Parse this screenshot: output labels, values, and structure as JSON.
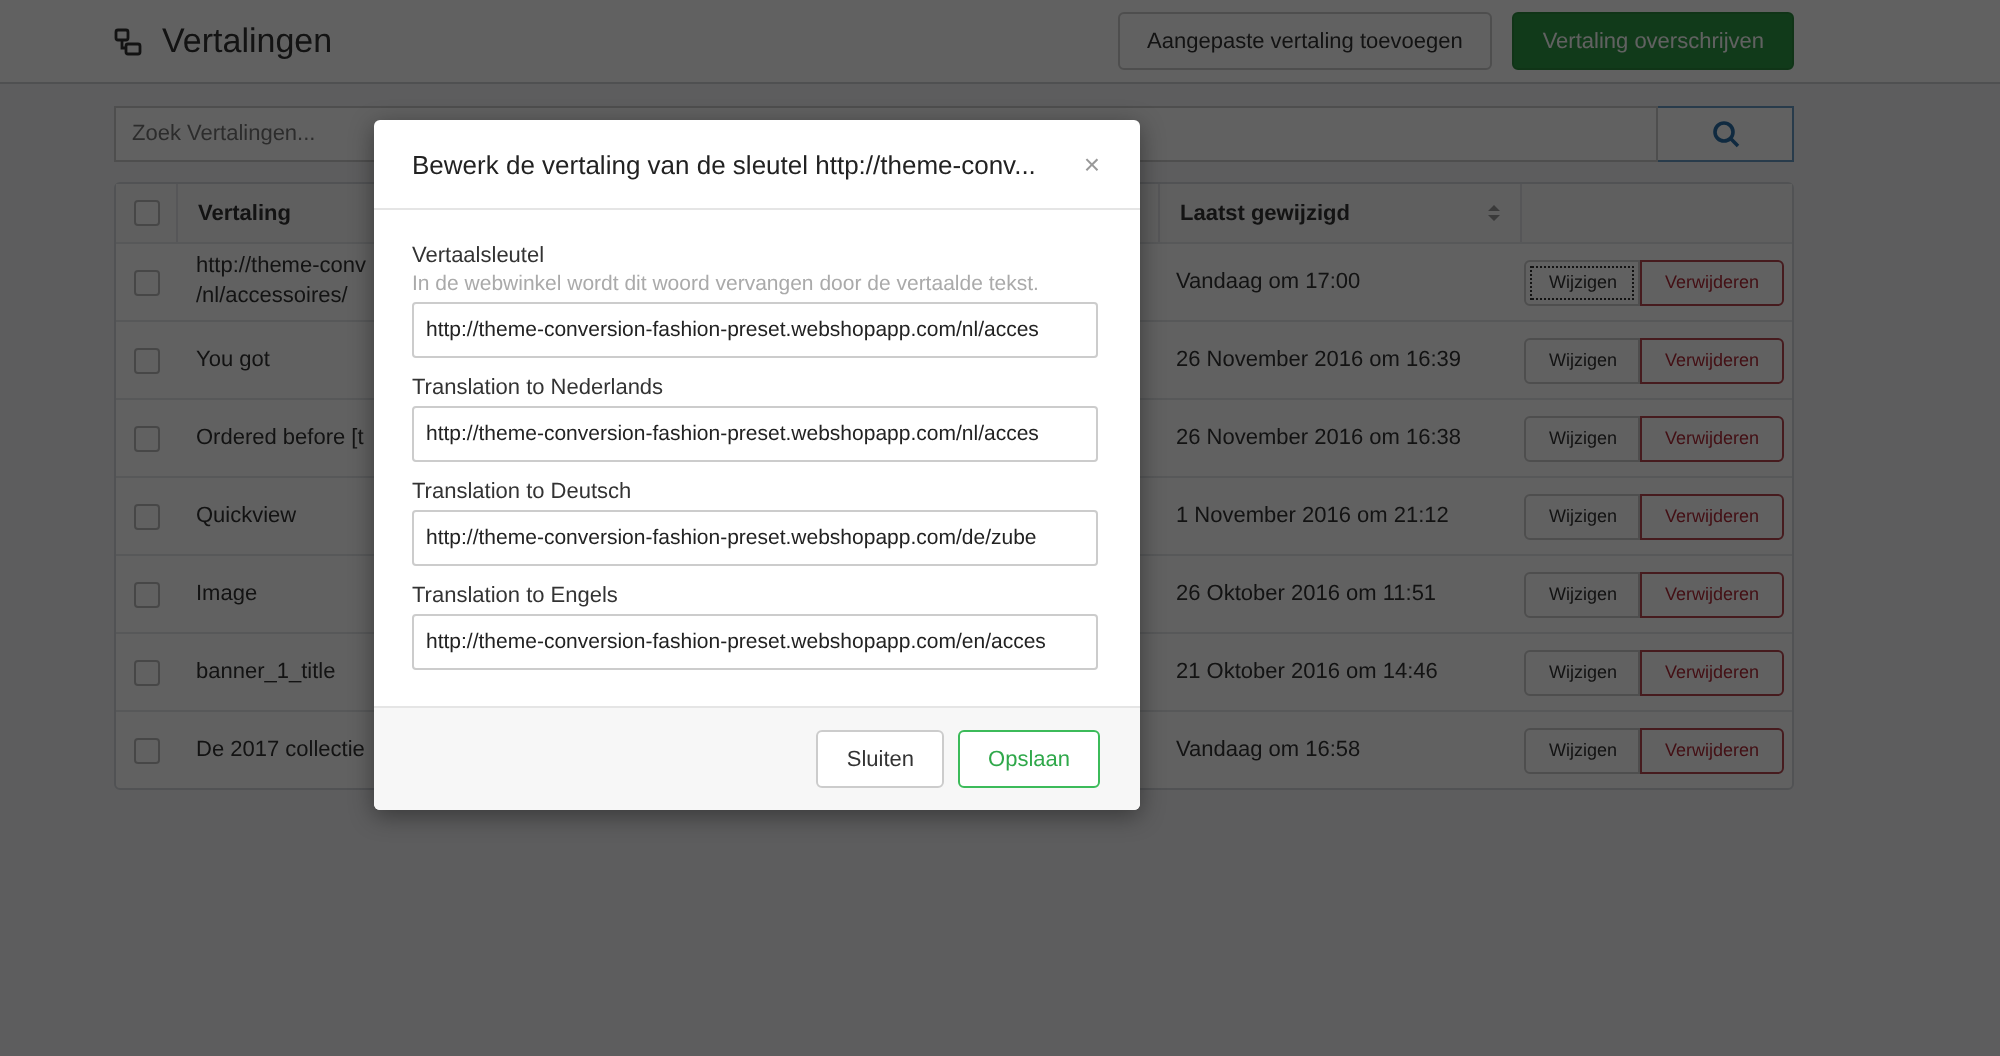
{
  "header": {
    "title": "Vertalingen",
    "buttons": [
      {
        "label": "Aangepaste vertaling toevoegen",
        "kind": "default"
      },
      {
        "label": "Vertaling overschrijven",
        "kind": "primary"
      }
    ]
  },
  "search": {
    "placeholder": "Zoek Vertalingen..."
  },
  "table": {
    "all_checked": false,
    "columns": [
      {
        "label": "Vertaling",
        "sortable": false
      },
      {
        "label": "Laatst gewijzigd",
        "sortable": true
      }
    ],
    "rows": [
      {
        "checked": false,
        "lines": [
          "http://theme-conv",
          "/nl/accessoires/"
        ],
        "modified": "Vandaag om 17:00",
        "edit": "Wijzigen",
        "delete": "Verwijderen",
        "edit_focused": true
      },
      {
        "checked": false,
        "lines": [
          "You got"
        ],
        "modified": "26 November 2016 om 16:39",
        "edit": "Wijzigen",
        "delete": "Verwijderen",
        "edit_focused": false
      },
      {
        "checked": false,
        "lines": [
          "Ordered before [t"
        ],
        "modified": "26 November 2016 om 16:38",
        "edit": "Wijzigen",
        "delete": "Verwijderen",
        "edit_focused": false
      },
      {
        "checked": false,
        "lines": [
          "Quickview"
        ],
        "modified": "1 November 2016 om 21:12",
        "edit": "Wijzigen",
        "delete": "Verwijderen",
        "edit_focused": false
      },
      {
        "checked": false,
        "lines": [
          "Image"
        ],
        "modified": "26 Oktober 2016 om 11:51",
        "edit": "Wijzigen",
        "delete": "Verwijderen",
        "edit_focused": false
      },
      {
        "checked": false,
        "lines": [
          "banner_1_title"
        ],
        "modified": "21 Oktober 2016 om 14:46",
        "edit": "Wijzigen",
        "delete": "Verwijderen",
        "edit_focused": false
      },
      {
        "checked": false,
        "lines": [
          "De 2017 collectie"
        ],
        "modified": "Vandaag om 16:58",
        "edit": "Wijzigen",
        "delete": "Verwijderen",
        "edit_focused": false
      }
    ]
  },
  "modal": {
    "title": "Bewerk de vertaling van de sleutel http://theme-conv...",
    "close": "×",
    "fields": [
      {
        "label": "Vertaalsleutel",
        "help": "In de webwinkel wordt dit woord vervangen door de vertaalde tekst.",
        "value": "http://theme-conversion-fashion-preset.webshopapp.com/nl/acces"
      },
      {
        "label": "Translation to Nederlands",
        "value": "http://theme-conversion-fashion-preset.webshopapp.com/nl/acces"
      },
      {
        "label": "Translation to Deutsch",
        "value": "http://theme-conversion-fashion-preset.webshopapp.com/de/zube"
      },
      {
        "label": "Translation to Engels",
        "value": "http://theme-conversion-fashion-preset.webshopapp.com/en/acces"
      }
    ],
    "buttons": [
      {
        "label": "Sluiten",
        "kind": "default"
      },
      {
        "label": "Opslaan",
        "kind": "success"
      }
    ]
  }
}
